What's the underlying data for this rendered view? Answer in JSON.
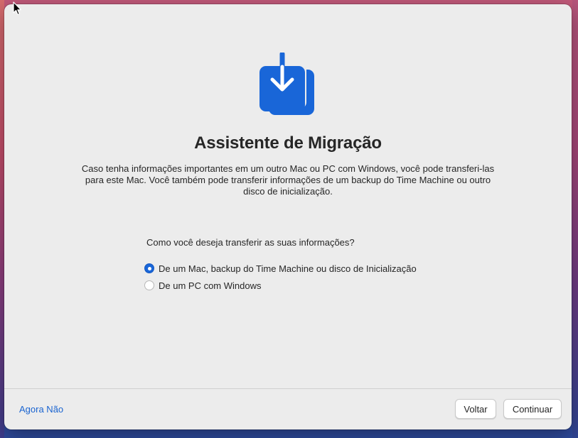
{
  "colors": {
    "accent": "#1966d8",
    "window_bg": "#ececec",
    "link": "#1a64d0"
  },
  "app": {
    "icon": "migration-assistant-icon",
    "title": "Assistente de Migração",
    "description_lines": [
      "Caso tenha informações importantes em um outro Mac ou PC com Windows, você pode transferi-las",
      "para este Mac. Você também pode transferir informações de um backup do Time Machine ou outro",
      "disco de inicialização."
    ]
  },
  "transfer": {
    "question": "Como você deseja transferir as suas informações?",
    "options": [
      {
        "label": "De um Mac, backup do Time Machine ou disco de Inicialização",
        "selected": true
      },
      {
        "label": "De um PC com Windows",
        "selected": false
      }
    ]
  },
  "footer": {
    "not_now_label": "Agora Não",
    "back_label": "Voltar",
    "continue_label": "Continuar"
  }
}
